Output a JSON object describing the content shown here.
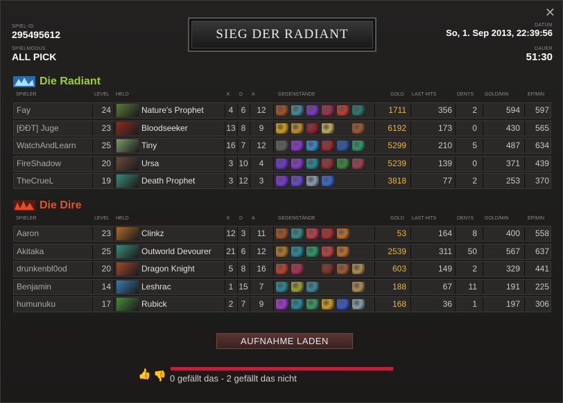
{
  "header": {
    "match_id_label": "SPIEL-ID",
    "match_id": "295495612",
    "mode_label": "SPIELMODUS",
    "mode": "ALL PICK",
    "title": "SIEG DER RADIANT",
    "date_label": "DATUM",
    "date": "So, 1. Sep 2013, 22:39:56",
    "duration_label": "DAUER",
    "duration": "51:30"
  },
  "columns": {
    "player": "SPIELER",
    "level": "LEVEL",
    "hero": "HELD",
    "k": "K",
    "d": "D",
    "a": "A",
    "items": "GEGENSTÄNDE",
    "gold": "GOLD",
    "last_hits": "LAST HITS",
    "denies": "DENYS",
    "gpm": "GOLD/MIN",
    "xpm": "EP/MIN"
  },
  "radiant": {
    "name": "Die Radiant",
    "color": "#9bd12f",
    "players": [
      {
        "name": "Fay",
        "level": "24",
        "hero": "Nature's Prophet",
        "k": "4",
        "d": "6",
        "a": "12",
        "gold": "1711",
        "lh": "356",
        "dn": "2",
        "gpm": "594",
        "xpm": "597",
        "hero_color": "#5a7a3a",
        "items": [
          "#a0552a",
          "#4a8a9a",
          "#7a3ac0",
          "#a03050",
          "#c04030",
          "#2a7a6a"
        ]
      },
      {
        "name": "[ÐÐT] Juge",
        "level": "23",
        "hero": "Bloodseeker",
        "k": "13",
        "d": "8",
        "a": "9",
        "gold": "6192",
        "lh": "173",
        "dn": "0",
        "gpm": "430",
        "xpm": "565",
        "hero_color": "#8a3020",
        "items": [
          "#d0a020",
          "#c09030",
          "#902030",
          "#c0b060",
          "#2a2928",
          "#a05a30"
        ]
      },
      {
        "name": "WatchAndLearn",
        "level": "25",
        "hero": "Tiny",
        "k": "16",
        "d": "7",
        "a": "12",
        "gold": "5299",
        "lh": "210",
        "dn": "5",
        "gpm": "487",
        "xpm": "634",
        "hero_color": "#7a9a6a",
        "items": [
          "#606060",
          "#8a3ad0",
          "#3a8ad0",
          "#a02a30",
          "#2a5ab0",
          "#2a9a6a"
        ]
      },
      {
        "name": "FireShadow",
        "level": "20",
        "hero": "Ursa",
        "k": "3",
        "d": "10",
        "a": "4",
        "gold": "5239",
        "lh": "139",
        "dn": "0",
        "gpm": "371",
        "xpm": "439",
        "hero_color": "#6a4a3a",
        "items": [
          "#6a3ad0",
          "#8a3ad0",
          "#2a8a9a",
          "#9a3030",
          "#3a8a3a",
          "#a04050"
        ]
      },
      {
        "name": "TheCrueL",
        "level": "19",
        "hero": "Death Prophet",
        "k": "3",
        "d": "12",
        "a": "3",
        "gold": "3818",
        "lh": "77",
        "dn": "2",
        "gpm": "253",
        "xpm": "370",
        "hero_color": "#3a8a7a",
        "items": [
          "#7a3ad0",
          "#6a4ad0",
          "#8aa0b0",
          "#3a6ad0",
          "#2a2928",
          "#2a2928"
        ]
      }
    ]
  },
  "dire": {
    "name": "Die Dire",
    "color": "#e0532a",
    "players": [
      {
        "name": "Aaron",
        "level": "23",
        "hero": "Clinkz",
        "k": "12",
        "d": "3",
        "a": "11",
        "gold": "53",
        "lh": "164",
        "dn": "8",
        "gpm": "400",
        "xpm": "558",
        "hero_color": "#b06a2a",
        "items": [
          "#a0552a",
          "#3a8a8a",
          "#c04050",
          "#b03030",
          "#c07030",
          "#2a2928"
        ]
      },
      {
        "name": "Akitaka",
        "level": "25",
        "hero": "Outworld Devourer",
        "k": "21",
        "d": "6",
        "a": "12",
        "gold": "2539",
        "lh": "311",
        "dn": "50",
        "gpm": "567",
        "xpm": "637",
        "hero_color": "#3a8a7a",
        "items": [
          "#b07a2a",
          "#2a8a9a",
          "#2a9a6a",
          "#c04040",
          "#c07030",
          "#2a2928"
        ]
      },
      {
        "name": "drunkenbl0od",
        "level": "20",
        "hero": "Dragon Knight",
        "k": "5",
        "d": "8",
        "a": "16",
        "gold": "603",
        "lh": "149",
        "dn": "2",
        "gpm": "329",
        "xpm": "441",
        "hero_color": "#a04a2a",
        "items": [
          "#c04030",
          "#b03050",
          "#2a2928",
          "#803020",
          "#a05a30",
          "#b09050"
        ]
      },
      {
        "name": "Benjamin",
        "level": "14",
        "hero": "Leshrac",
        "k": "1",
        "d": "15",
        "a": "7",
        "gold": "188",
        "lh": "67",
        "dn": "11",
        "gpm": "191",
        "xpm": "225",
        "hero_color": "#3a7ab0",
        "items": [
          "#2a8a9a",
          "#a0a030",
          "#3a8aa0",
          "#2a2928",
          "#2a2928",
          "#b09050"
        ]
      },
      {
        "name": "humunuku",
        "level": "17",
        "hero": "Rubick",
        "k": "2",
        "d": "7",
        "a": "9",
        "gold": "168",
        "lh": "36",
        "dn": "1",
        "gpm": "197",
        "xpm": "306",
        "hero_color": "#4a8a3a",
        "items": [
          "#a03ad0",
          "#2a8a9a",
          "#3a9a6a",
          "#d0a020",
          "#3a5ad0",
          "#8aa0b0"
        ]
      }
    ]
  },
  "download_button": "AUFNAHME LADEN",
  "votes": {
    "text": "0 gefällt das - 2 gefällt das nicht",
    "bar_color": "#c0203a"
  }
}
